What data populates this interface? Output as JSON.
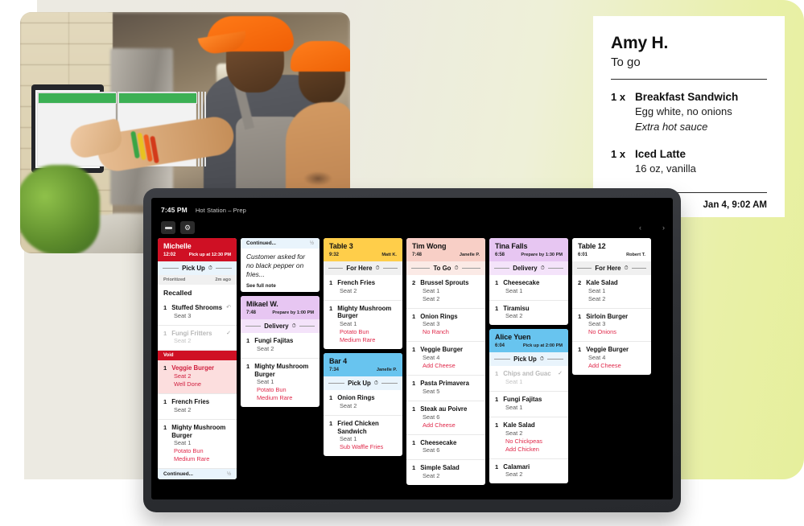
{
  "receipt": {
    "customer": "Amy H.",
    "order_type": "To go",
    "date": "Jan 4, 9:02 AM",
    "items": [
      {
        "qty": "1 x",
        "name": "Breakfast Sandwich",
        "mods": [
          "Egg white, no onions"
        ],
        "notes": [
          "Extra hot sauce"
        ]
      },
      {
        "qty": "1 x",
        "name": "Iced Latte",
        "mods": [
          "16 oz, vanilla"
        ],
        "notes": []
      }
    ]
  },
  "kds": {
    "time": "7:45 PM",
    "station": "Hot Station – Prep",
    "nav_prev": "‹",
    "nav_next": "›",
    "menu_icon": "list-icon",
    "refresh_icon": "refresh-icon",
    "columns": [
      {
        "cards": [
          {
            "kind": "ticket",
            "header_color": "red",
            "title": "Michelle",
            "time": "12:02",
            "server": "Pick up at 12:30 PM",
            "fulfillment": {
              "label": "Pick Up",
              "style": "pick"
            },
            "priority": {
              "left": "Prioritized",
              "right": "2m ago"
            },
            "status": "Recalled",
            "items": [
              {
                "qty": "1",
                "name": "Stuffed Shrooms",
                "seat": "Seat 3",
                "mods": [],
                "state": "recalled",
                "icon": "undo-icon"
              },
              {
                "qty": "1",
                "name": "Fungi Fritters",
                "seat": "Seat 2",
                "mods": [],
                "state": "done",
                "icon": "check-icon"
              }
            ],
            "void_label": "Void",
            "void_items": [
              {
                "qty": "1",
                "name": "Veggie Burger",
                "seat": "Seat 2",
                "mods": [
                  "Well Done"
                ]
              }
            ],
            "items_after": [
              {
                "qty": "1",
                "name": "French Fries",
                "seat": "Seat 2",
                "mods": []
              },
              {
                "qty": "1",
                "name": "Mighty Mushroom Burger",
                "seat": "Seat 1",
                "mods": [
                  "Potato Bun",
                  "Medium Rare"
                ]
              }
            ],
            "footer": {
              "left": "Continued...",
              "right": "½"
            }
          }
        ]
      },
      {
        "cards": [
          {
            "kind": "note",
            "header": {
              "left": "Continued...",
              "right": "½"
            },
            "text": "Customer asked for no black pepper on fries...",
            "link": "See full note"
          },
          {
            "kind": "ticket",
            "header_color": "purple",
            "title": "Mikael W.",
            "time": "7:48",
            "server": "Prepare by 1:00 PM",
            "fulfillment": {
              "label": "Delivery",
              "style": "deliv"
            },
            "items": [
              {
                "qty": "1",
                "name": "Fungi Fajitas",
                "seat": "Seat 2",
                "mods": []
              },
              {
                "qty": "1",
                "name": "Mighty Mushroom Burger",
                "seat": "Seat 1",
                "mods": [
                  "Potato Bun",
                  "Medium Rare"
                ]
              }
            ]
          }
        ]
      },
      {
        "cards": [
          {
            "kind": "ticket",
            "header_color": "yellow",
            "title": "Table 3",
            "time": "9:32",
            "server": "Matt K.",
            "fulfillment": {
              "label": "For Here",
              "style": "here"
            },
            "items": [
              {
                "qty": "1",
                "name": "French Fries",
                "seat": "Seat 2",
                "mods": []
              },
              {
                "qty": "1",
                "name": "Mighty Mushroom Burger",
                "seat": "Seat 1",
                "mods": [
                  "Potato Bun",
                  "Medium Rare"
                ]
              }
            ]
          },
          {
            "kind": "ticket",
            "header_color": "blue",
            "title": "Bar 4",
            "time": "7:34",
            "server": "Janelle P.",
            "fulfillment": {
              "label": "Pick Up",
              "style": "pick"
            },
            "items": [
              {
                "qty": "1",
                "name": "Onion Rings",
                "seat": "Seat 2",
                "mods": []
              },
              {
                "qty": "1",
                "name": "Fried Chicken Sandwich",
                "seat": "Seat 1",
                "mods": [
                  "Sub Waffle Fries"
                ]
              }
            ]
          }
        ]
      },
      {
        "cards": [
          {
            "kind": "ticket",
            "header_color": "pink",
            "title": "Tim Wong",
            "time": "7:48",
            "server": "Janelle P.",
            "fulfillment": {
              "label": "To Go",
              "style": "togo"
            },
            "items": [
              {
                "qty": "2",
                "name": "Brussel Sprouts",
                "seat": "Seat 1",
                "seat2": "Seat 2",
                "mods": []
              },
              {
                "qty": "1",
                "name": "Onion Rings",
                "seat": "Seat 3",
                "mods": [
                  "No Ranch"
                ]
              },
              {
                "qty": "1",
                "name": "Veggie Burger",
                "seat": "Seat 4",
                "mods": [
                  "Add Cheese"
                ]
              },
              {
                "qty": "1",
                "name": "Pasta Primavera",
                "seat": "Seat 5",
                "mods": []
              },
              {
                "qty": "1",
                "name": "Steak au Poivre",
                "seat": "Seat 6",
                "mods": [
                  "Add Cheese"
                ]
              },
              {
                "qty": "1",
                "name": "Cheesecake",
                "seat": "Seat 6",
                "mods": []
              },
              {
                "qty": "1",
                "name": "Simple Salad",
                "seat": "Seat 2",
                "mods": []
              }
            ]
          }
        ]
      },
      {
        "cards": [
          {
            "kind": "ticket",
            "header_color": "purple",
            "title": "Tina Falls",
            "time": "6:58",
            "server": "Prepare by 1:30 PM",
            "fulfillment": {
              "label": "Delivery",
              "style": "deliv"
            },
            "items": [
              {
                "qty": "1",
                "name": "Cheesecake",
                "seat": "Seat 1",
                "mods": []
              },
              {
                "qty": "1",
                "name": "Tiramisu",
                "seat": "Seat 2",
                "mods": []
              }
            ]
          },
          {
            "kind": "ticket",
            "header_color": "blue",
            "title": "Alice Yuen",
            "time": "6:04",
            "server": "Pick up at 2:00 PM",
            "fulfillment": {
              "label": "Pick Up",
              "style": "pick"
            },
            "items": [
              {
                "qty": "1",
                "name": "Chips and Guac",
                "seat": "Seat 1",
                "mods": [],
                "state": "done",
                "icon": "check-icon"
              },
              {
                "qty": "1",
                "name": "Fungi Fajitas",
                "seat": "Seat 1",
                "mods": []
              },
              {
                "qty": "1",
                "name": "Kale Salad",
                "seat": "Seat 2",
                "mods": [
                  "No Chickpeas",
                  "Add Chicken"
                ]
              },
              {
                "qty": "1",
                "name": "Calamari",
                "seat": "Seat 2",
                "mods": []
              }
            ]
          }
        ]
      },
      {
        "cards": [
          {
            "kind": "ticket",
            "header_color": "white",
            "title": "Table 12",
            "time": "6:01",
            "server": "Robert T.",
            "fulfillment": {
              "label": "For Here",
              "style": "here"
            },
            "items": [
              {
                "qty": "2",
                "name": "Kale Salad",
                "seat": "Seat 1",
                "seat2": "Seat 2",
                "mods": []
              },
              {
                "qty": "1",
                "name": "Sirloin Burger",
                "seat": "Seat 3",
                "mods": [
                  "No Onions"
                ]
              },
              {
                "qty": "1",
                "name": "Veggie Burger",
                "seat": "Seat 4",
                "mods": [
                  "Add Cheese"
                ]
              }
            ]
          }
        ]
      }
    ]
  },
  "colors": {
    "red": "#cf1024",
    "yellow": "#ffce4a",
    "pink": "#f8cfc6",
    "purple": "#e7c6f2",
    "blue": "#68c4ef",
    "mod_red": "#e0294a",
    "bg_green": "#e6ef9c"
  }
}
